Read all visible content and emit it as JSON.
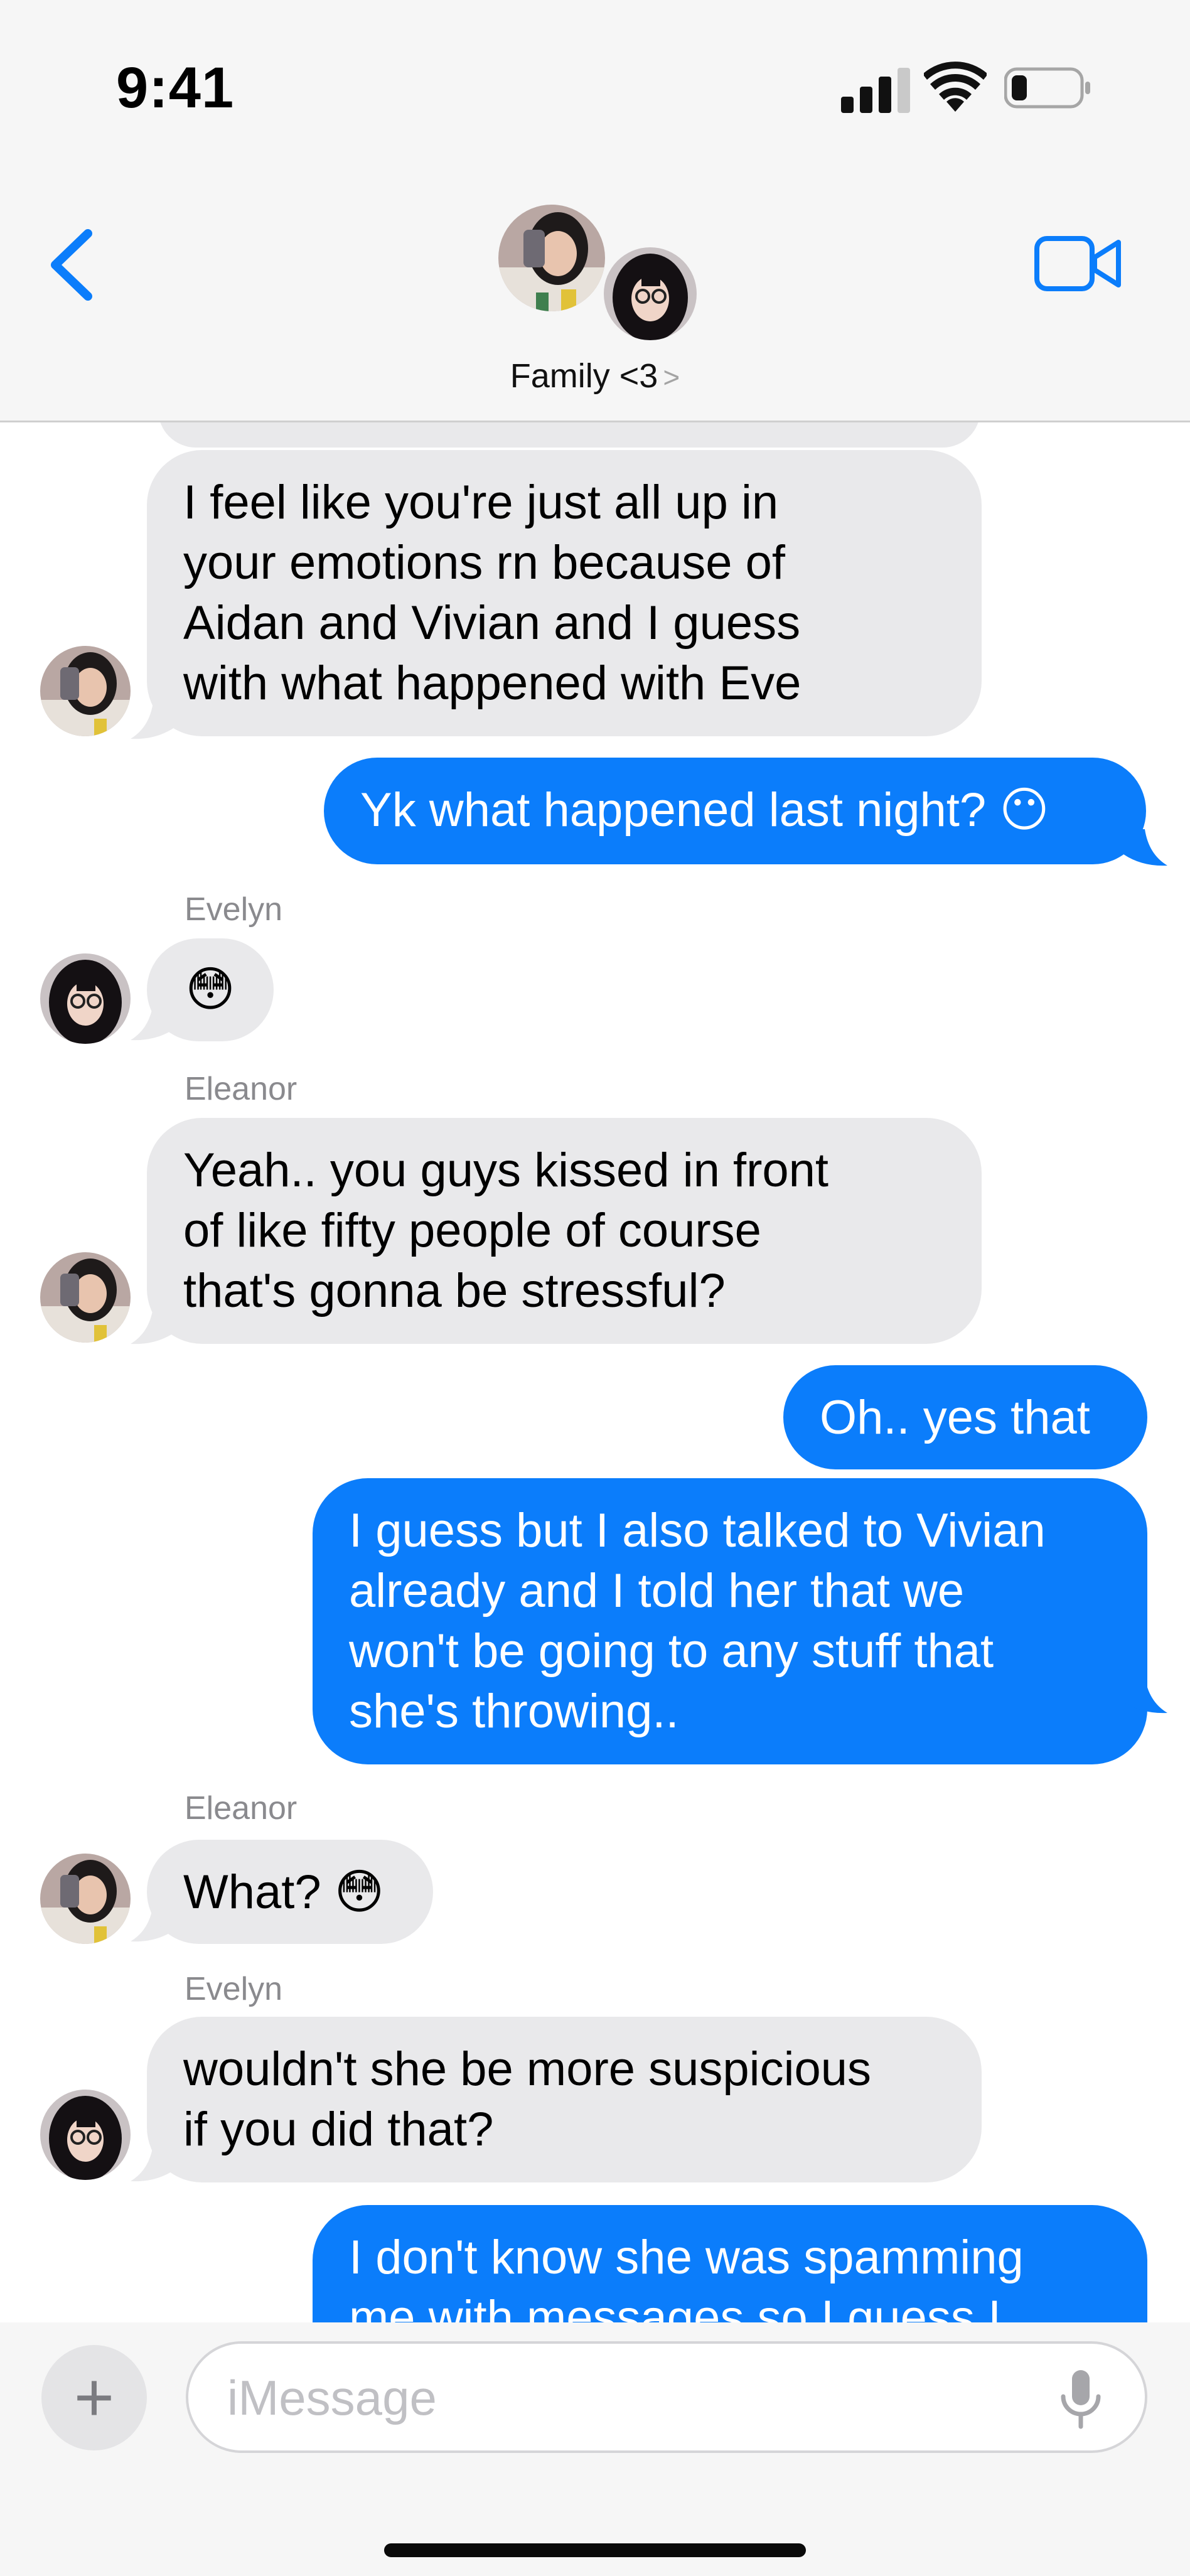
{
  "status_bar": {
    "time": "9:41",
    "signal_icon": "cellular-signal-icon",
    "wifi_icon": "wifi-icon",
    "battery_icon": "battery-low-icon",
    "battery_level": 0.2
  },
  "header": {
    "back_icon": "chevron-left-icon",
    "video_icon": "video-camera-icon",
    "group_name": "Family <3",
    "chevron": ">",
    "accent_color": "#0b7dfb"
  },
  "messages": [
    {
      "side": "in",
      "avatar": "eleanor",
      "lines": [
        "I feel like you're just all up in",
        "your emotions rn because of",
        "Aidan and Vivian and I guess",
        "with what happened with Eve"
      ]
    },
    {
      "side": "out",
      "lines": [
        "Yk what happened last night? 😶"
      ]
    },
    {
      "sender": "Evelyn"
    },
    {
      "side": "in",
      "avatar": "evelyn",
      "lines": [
        "😳"
      ]
    },
    {
      "sender": "Eleanor"
    },
    {
      "side": "in",
      "avatar": "eleanor",
      "lines": [
        "Yeah.. you guys kissed in front",
        "of like fifty people of course",
        "that's gonna be stressful?"
      ]
    },
    {
      "side": "out",
      "lines": [
        "Oh.. yes that"
      ]
    },
    {
      "side": "out",
      "lines": [
        "I guess but I also talked to Vivian",
        "already and I told her that we",
        "won't be going to any stuff that",
        "she's throwing.."
      ]
    },
    {
      "sender": "Eleanor"
    },
    {
      "side": "in",
      "avatar": "eleanor",
      "lines": [
        "What? 😳"
      ]
    },
    {
      "sender": "Evelyn"
    },
    {
      "side": "in",
      "avatar": "evelyn",
      "lines": [
        "wouldn't she be more suspicious",
        "if you did that?"
      ]
    },
    {
      "side": "out",
      "lines": [
        "I don't know she was spamming",
        "me with messages so I guess I"
      ]
    }
  ],
  "input": {
    "plus_label": "+",
    "placeholder": "iMessage",
    "mic_icon": "microphone-icon"
  },
  "colors": {
    "incoming_bubble": "#e9e9eb",
    "outgoing_bubble": "#0b7dfb",
    "sender_label": "#8a8a8e"
  }
}
